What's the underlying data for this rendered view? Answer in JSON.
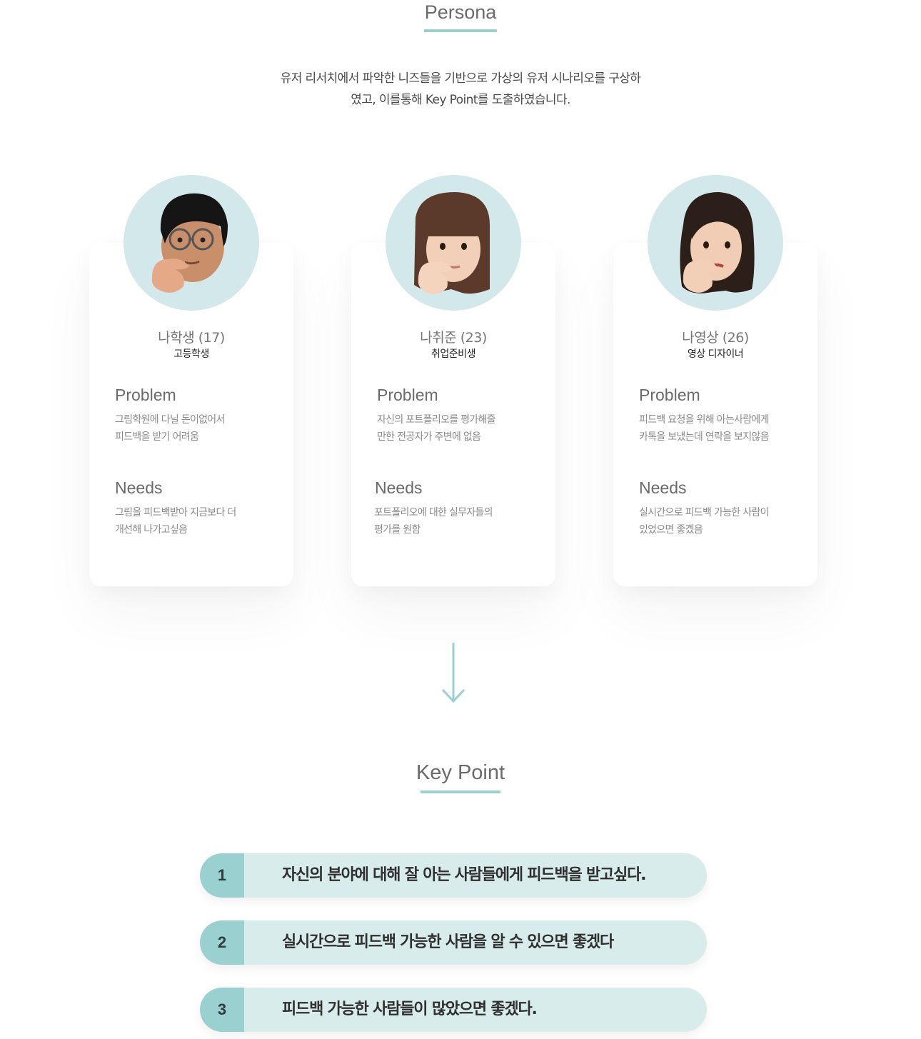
{
  "persona_section": {
    "title": "Persona",
    "intro_line1": "유저 리서치에서 파악한 니즈들을 기반으로 가상의 유저 시나리오를 구상하",
    "intro_line2": "였고, 이를통해 Key Point를 도출하였습니다."
  },
  "personas": [
    {
      "avatar_icon": "memoji-boy-glasses-icon",
      "name": "나학생 (17)",
      "role": "고등학생",
      "problem_heading": "Problem",
      "problem_line1": "그림학원에 다닐 돈이없어서",
      "problem_line2": "피드백을 받기 어려움",
      "needs_heading": "Needs",
      "needs_line1": "그림을 피드백받아 지금보다 더",
      "needs_line2": "개선해 나가고싶음"
    },
    {
      "avatar_icon": "memoji-girl-bangs-icon",
      "name": "나취준 (23)",
      "role": "취업준비생",
      "problem_heading": "Problem",
      "problem_line1": "자신의 포트폴리오를 평가해줄",
      "problem_line2": "만한 전공자가 주변에 없음",
      "needs_heading": "Needs",
      "needs_line1": "포트폴리오에 대한 실무자들의",
      "needs_line2": "평가를 원함"
    },
    {
      "avatar_icon": "memoji-woman-long-hair-icon",
      "name": "나영상 (26)",
      "role": "영상 디자이너",
      "problem_heading": "Problem",
      "problem_line1": "피드백 요청을 위해 아는사람에게",
      "problem_line2": "카톡을 보냈는데 연락을 보지않음",
      "needs_heading": "Needs",
      "needs_line1": "실시간으로 피드백 가능한 사람이",
      "needs_line2": "있었으면 좋겠음"
    }
  ],
  "arrow_icon": "arrow-down-icon",
  "keypoint_section": {
    "title": "Key Point",
    "items": [
      {
        "number": "1",
        "text": "자신의 분야에 대해 잘 아는 사람들에게 피드백을 받고싶다."
      },
      {
        "number": "2",
        "text": "실시간으로 피드백 가능한 사람을 알 수 있으면 좋겠다"
      },
      {
        "number": "3",
        "text": "피드백 가능한 사람들이 많았으면 좋겠다."
      }
    ]
  },
  "colors": {
    "accent": "#9ad0d0",
    "accent_light": "#d9ecec",
    "avatar_bg": "#d3e8ea"
  }
}
